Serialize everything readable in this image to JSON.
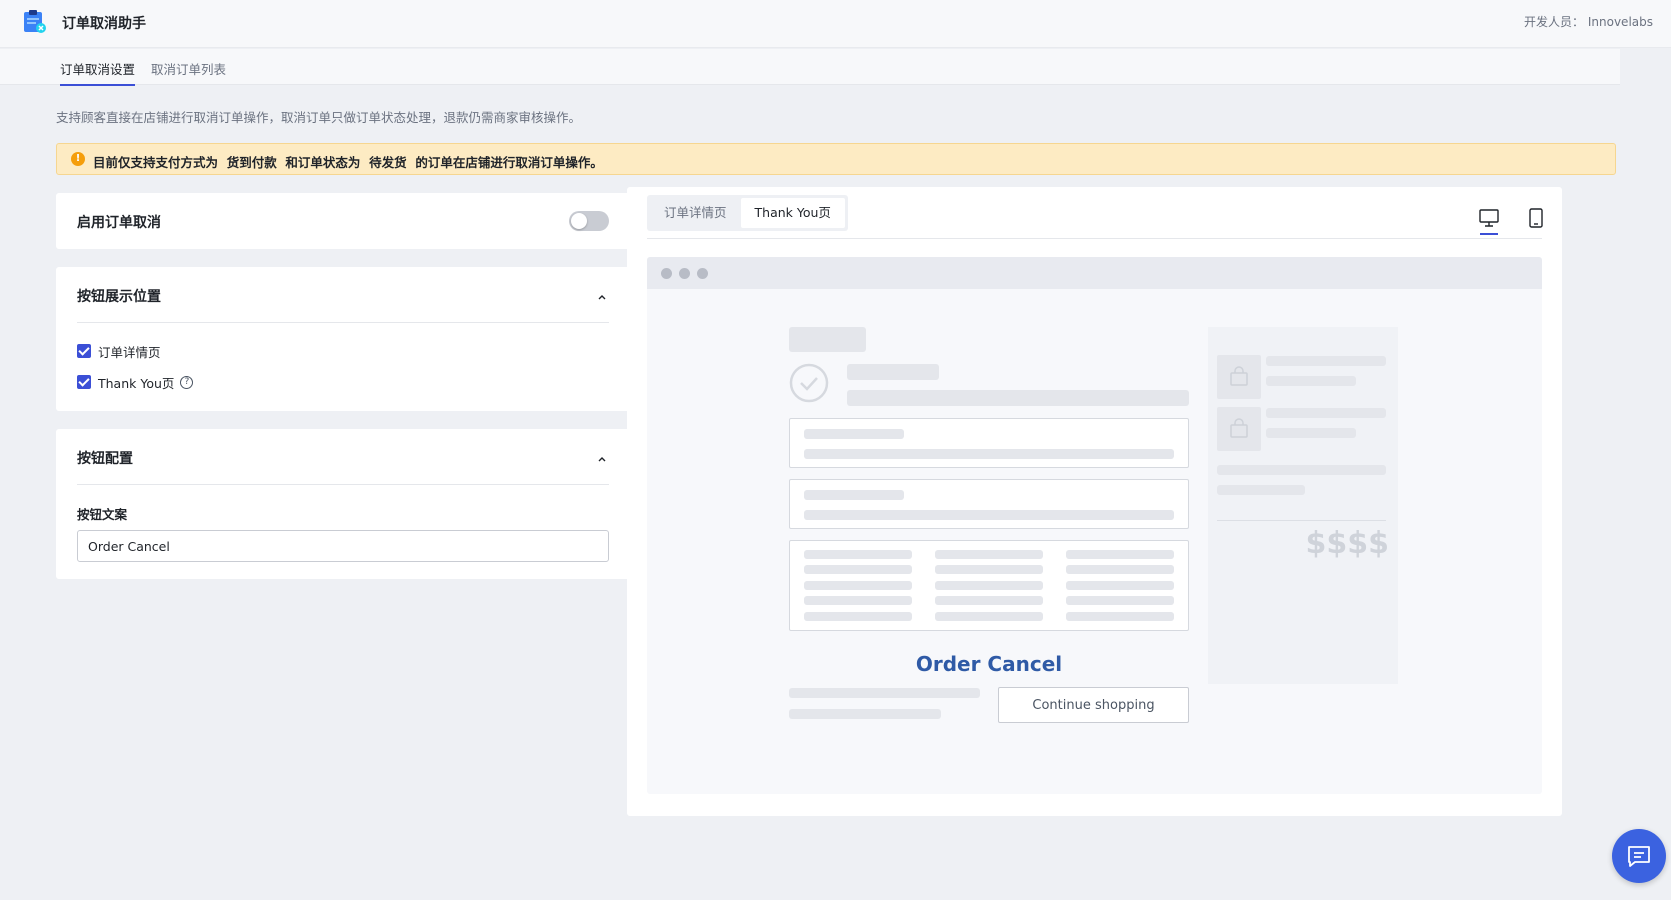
{
  "app": {
    "title": "订单取消助手",
    "developer": "开发人员： Innovelabs",
    "logo_icon": "clipboard-cancel-icon"
  },
  "tabs": [
    {
      "label": "订单取消设置",
      "active": true
    },
    {
      "label": "取消订单列表",
      "active": false
    }
  ],
  "description": "支持顾客直接在店铺进行取消订单操作，取消订单只做订单状态处理，退款仍需商家审核操作。",
  "notice": {
    "icon": "warning-icon",
    "icon_glyph": "!",
    "text": "目前仅支持支付方式为  货到付款  和订单状态为  待发货  的订单在店铺进行取消订单操作。"
  },
  "enable_card": {
    "title": "启用订单取消",
    "enabled": false
  },
  "position_card": {
    "title": "按钮展示位置",
    "options": [
      {
        "label": "订单详情页",
        "checked": true
      },
      {
        "label": "Thank You页",
        "checked": true,
        "help_glyph": "?"
      }
    ]
  },
  "config_card": {
    "title": "按钮配置",
    "field_label": "按钮文案",
    "field_value": "Order Cancel"
  },
  "preview": {
    "segments": [
      {
        "label": "订单详情页",
        "active": false
      },
      {
        "label": "Thank You页",
        "active": true
      }
    ],
    "devices": [
      "desktop-icon",
      "tablet-icon"
    ],
    "active_device": "desktop",
    "order_cancel_label": "Order Cancel",
    "continue_label": "Continue shopping",
    "price_placeholder": "$$$$"
  },
  "colors": {
    "accent": "#3b4fd6",
    "notice_bg": "#fdebc3",
    "order_cancel_text": "#2f5aa6",
    "chat_fab": "#3b62e0"
  },
  "chat": {
    "icon": "chat-icon"
  }
}
